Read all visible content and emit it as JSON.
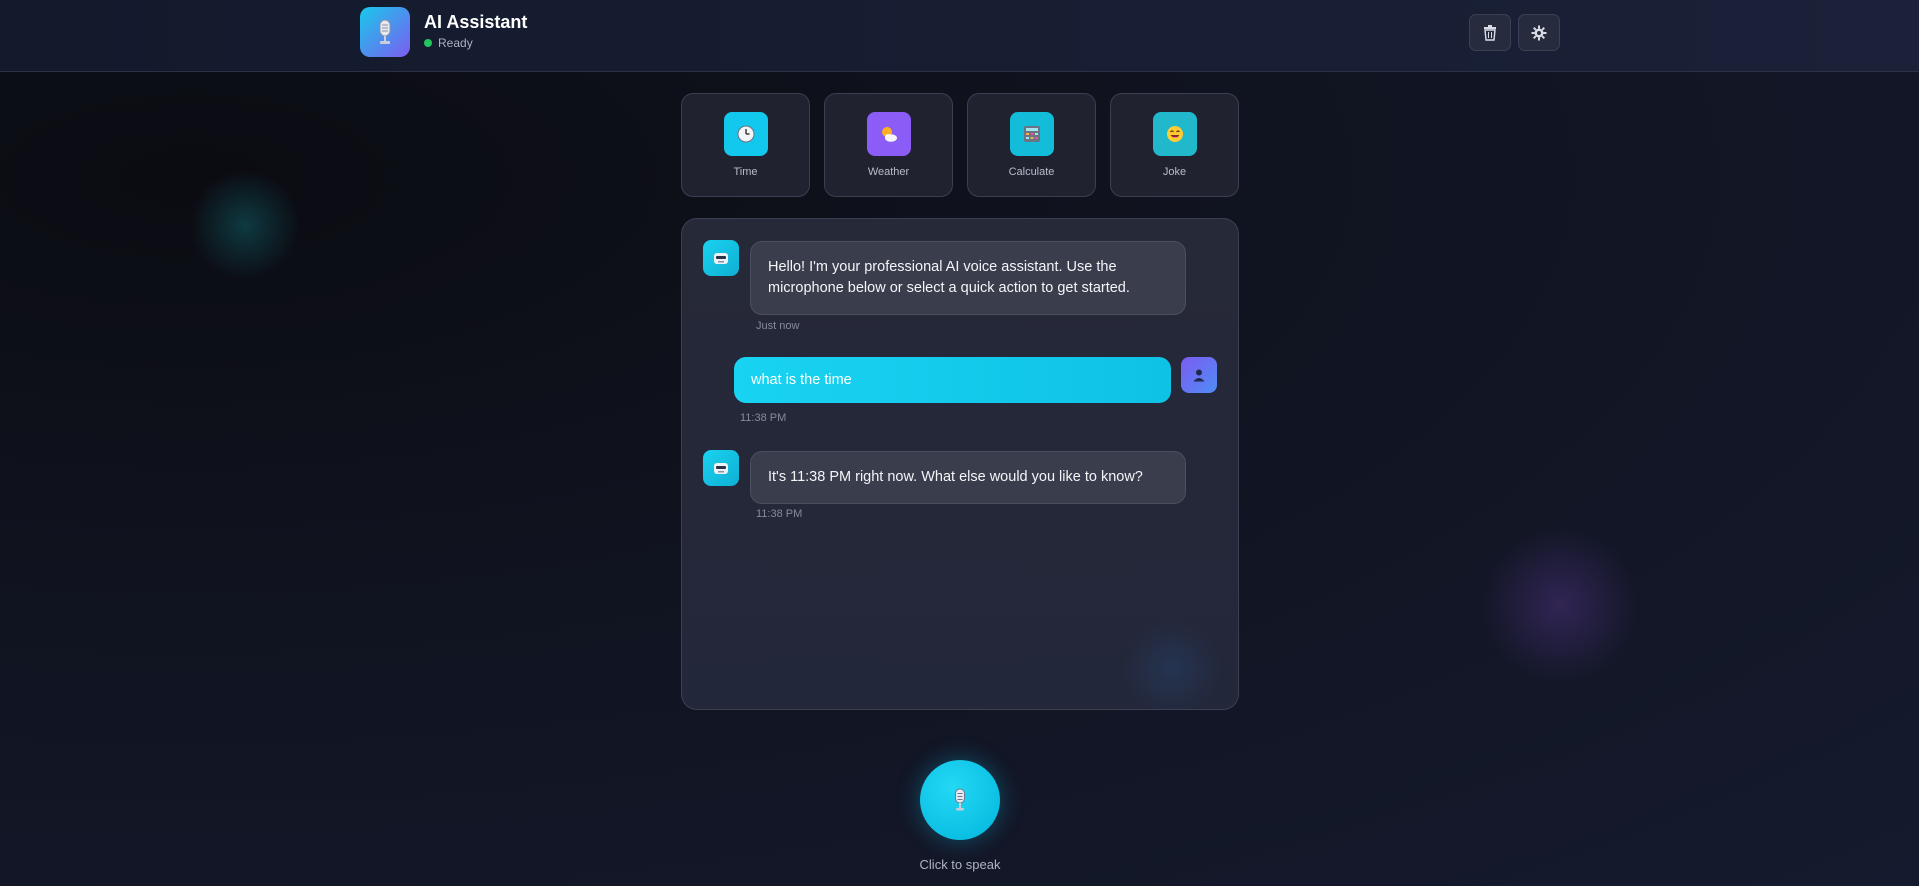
{
  "header": {
    "title": "AI Assistant",
    "status": "Ready",
    "status_color": "#22c55e",
    "logo_icon": "microphone-icon",
    "buttons": [
      {
        "name": "clear-chat-button",
        "icon": "trash-icon"
      },
      {
        "name": "settings-button",
        "icon": "gear-icon"
      }
    ]
  },
  "quick_actions": [
    {
      "label": "Time",
      "icon": "clock-icon",
      "color": "#12c8ec"
    },
    {
      "label": "Weather",
      "icon": "sun-cloud-icon",
      "color": "#8b5cf6"
    },
    {
      "label": "Calculate",
      "icon": "calculator-icon",
      "color": "#13bcd8"
    },
    {
      "label": "Joke",
      "icon": "laughing-face-icon",
      "color": "#22b8cc"
    }
  ],
  "messages": [
    {
      "role": "assistant",
      "text": "Hello! I'm your professional AI voice assistant. Use the microphone below or select a quick action to get started.",
      "time": "Just now"
    },
    {
      "role": "user",
      "text": "what is the time",
      "time": "11:38 PM"
    },
    {
      "role": "assistant",
      "text": "It's 11:38 PM right now. What else would you like to know?",
      "time": "11:38 PM"
    }
  ],
  "mic": {
    "hint": "Click to speak",
    "icon": "microphone-icon"
  },
  "colors": {
    "accent": "#12c8ec",
    "secondary": "#7c5cf0"
  }
}
